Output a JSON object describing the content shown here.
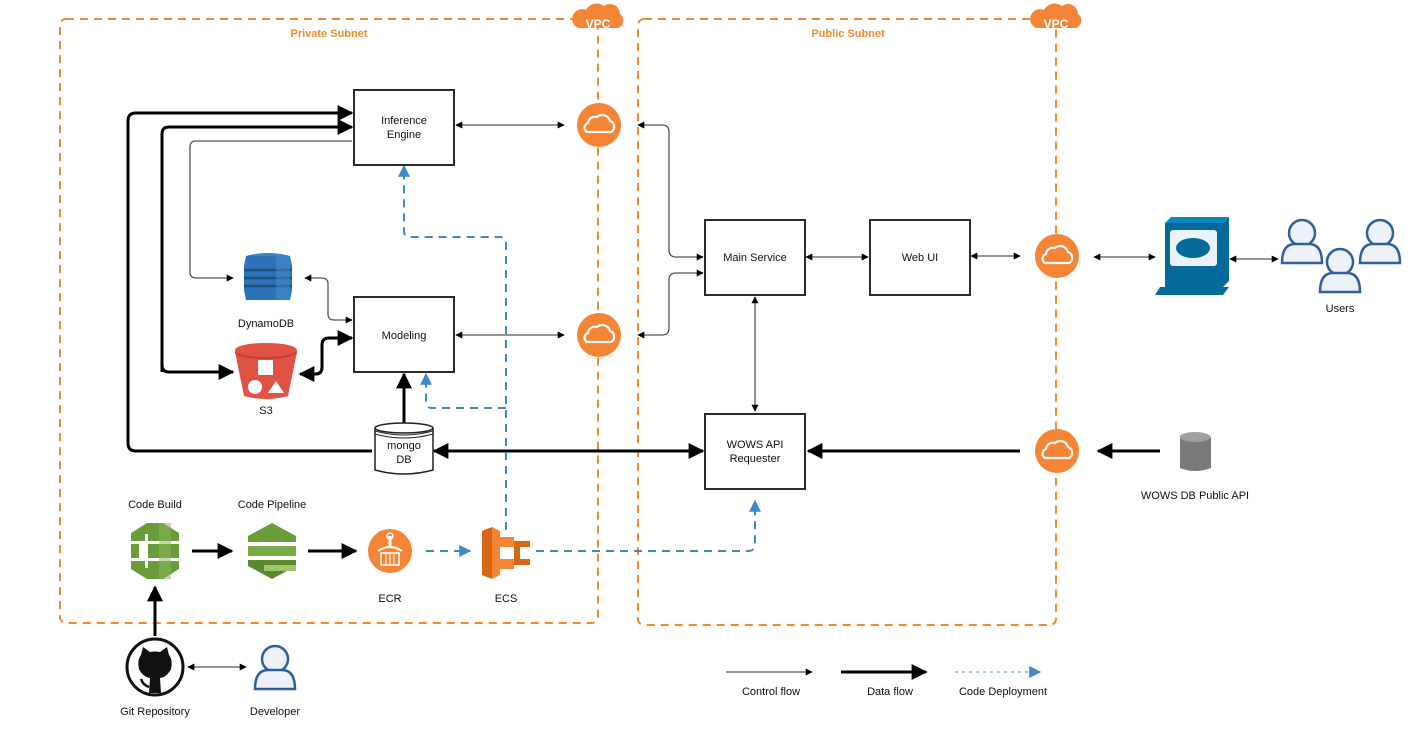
{
  "colors": {
    "subnet_border": "#ef8b2c",
    "vpc_cloud": "#f58536",
    "deploy_line": "#3f88cc",
    "dynamodb": "#2e73b8",
    "s3": "#e05243",
    "codebuild": "#6b9c3a",
    "users_stroke": "#2e5f9e",
    "terminal": "#036a9a",
    "public_api_db": "#808080"
  },
  "subnets": {
    "private": {
      "title": "Private Subnet",
      "badge": "VPC"
    },
    "public": {
      "title": "Public Subnet",
      "badge": "VPC"
    }
  },
  "nodes": {
    "inference_engine": {
      "line1": "Inference",
      "line2": "Engine"
    },
    "modeling": {
      "label": "Modeling"
    },
    "dynamodb": {
      "label": "DynamoDB",
      "icon": "dynamodb-icon"
    },
    "s3": {
      "label": "S3",
      "icon": "s3-bucket-icon"
    },
    "mongodb": {
      "line1": "mongo",
      "line2": "DB",
      "icon": "database-cylinder-icon"
    },
    "main_service": {
      "label": "Main Service"
    },
    "web_ui": {
      "label": "Web UI"
    },
    "wows_api_requester": {
      "line1": "WOWS API",
      "line2": "Requester"
    },
    "code_build": {
      "label": "Code Build",
      "icon": "codebuild-icon"
    },
    "code_pipeline": {
      "label": "Code Pipeline",
      "icon": "codepipeline-icon"
    },
    "ecr": {
      "label": "ECR",
      "icon": "ecr-icon"
    },
    "ecs": {
      "label": "ECS",
      "icon": "ecs-icon"
    },
    "git_repository": {
      "label": "Git Repository",
      "icon": "github-icon"
    },
    "developer": {
      "label": "Developer",
      "icon": "user-icon"
    },
    "users": {
      "label": "Users",
      "icon": "users-group-icon"
    },
    "terminal": {
      "icon": "client-terminal-icon"
    },
    "wows_db_public_api": {
      "label": "WOWS DB Public API",
      "icon": "database-icon"
    },
    "gateways": [
      "internet-gateway-icon",
      "internet-gateway-icon",
      "internet-gateway-icon",
      "internet-gateway-icon"
    ]
  },
  "legend": {
    "control_flow": "Control flow",
    "data_flow": "Data flow",
    "code_deployment": "Code Deployment"
  }
}
